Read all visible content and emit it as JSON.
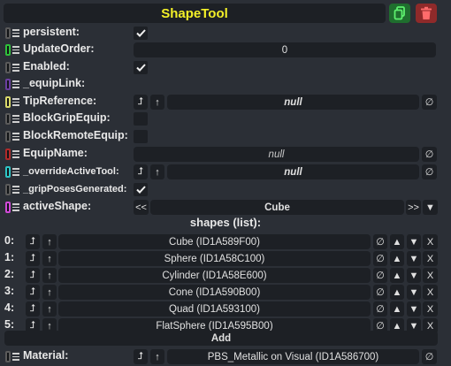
{
  "component": {
    "title": "ShapeTool",
    "duplicate_icon": "duplicate-icon",
    "delete_icon": "trash-icon"
  },
  "fields": {
    "persistent": {
      "label": "persistent:",
      "checked": true,
      "indicator_color": "#5a5a5a"
    },
    "update_order": {
      "label": "UpdateOrder:",
      "value": "0",
      "indicator_color": "#2fbf3a"
    },
    "enabled": {
      "label": "Enabled:",
      "checked": true,
      "indicator_color": "#5a5a5a"
    },
    "equip_link": {
      "label": "_equipLink:",
      "indicator_color": "#6b3fa0"
    },
    "tip_reference": {
      "label": "TipReference:",
      "value": "null",
      "indicator_color": "#d8d86a"
    },
    "block_grip_equip": {
      "label": "BlockGripEquip:",
      "checked": false
    },
    "block_remote_equip": {
      "label": "BlockRemoteEquip:",
      "checked": false
    },
    "equip_name": {
      "label": "EquipName:",
      "value": "null",
      "indicator_color": "#b02a2a"
    },
    "override_active_tool": {
      "label": "_overrideActiveTool:",
      "value": "null",
      "indicator_color": "#2ec4c4"
    },
    "grip_poses_generated": {
      "label": "_gripPosesGenerated:",
      "checked": true
    },
    "active_shape": {
      "label": "activeShape:",
      "value": "Cube",
      "indicator_color": "#d04ad8",
      "prev_label": "<<",
      "next_label": ">>"
    }
  },
  "shapes": {
    "title": "shapes (list):",
    "items": [
      {
        "index": "0:",
        "value": "Cube (ID1A589F00)"
      },
      {
        "index": "1:",
        "value": "Sphere (ID1A58C100)"
      },
      {
        "index": "2:",
        "value": "Cylinder (ID1A58E600)"
      },
      {
        "index": "3:",
        "value": "Cone (ID1A590B00)"
      },
      {
        "index": "4:",
        "value": "Quad (ID1A593100)"
      },
      {
        "index": "5:",
        "value": "FlatSphere (ID1A595B00)"
      }
    ],
    "add_label": "Add"
  },
  "material": {
    "label": "Material:",
    "value": "PBS_Metallic on Visual (ID1A586700)",
    "indicator_color": "#5a5a5a"
  },
  "glyphs": {
    "null_btn": "∅",
    "up": "▲",
    "down": "▼",
    "remove": "X",
    "jump": "⮥",
    "arrow_up": "↑"
  },
  "colors": {
    "title": "#f3f028",
    "duplicate_bg": "#1f6e2e",
    "delete_bg": "#8f2a2a",
    "panel_bg": "#2b2f36",
    "field_bg": "#1d2025"
  }
}
